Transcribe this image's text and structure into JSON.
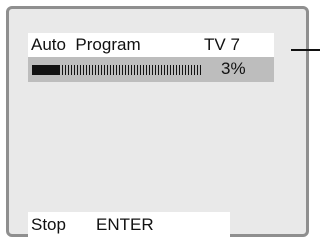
{
  "header": {
    "label": "Auto  Program",
    "channel": "TV 7"
  },
  "progress": {
    "label": "3%",
    "fraction": 0.03
  },
  "footer": {
    "stop_label": "Stop",
    "enter_label": "ENTER"
  },
  "colors": {
    "screen_background": "#e9e9e9",
    "highlight_bar": "#bdbdbd",
    "text": "#111111"
  }
}
